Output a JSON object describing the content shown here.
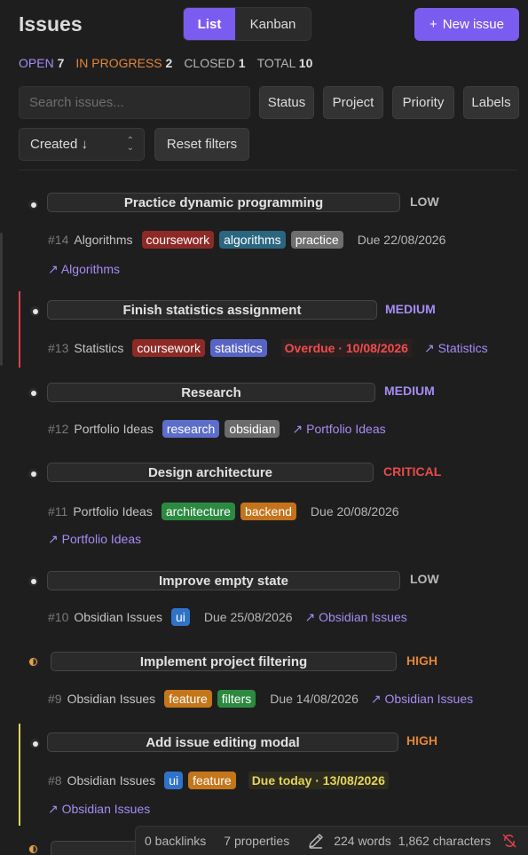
{
  "header": {
    "title": "Issues",
    "view_list": "List",
    "view_kanban": "Kanban",
    "new_issue": "New issue",
    "new_issue_icon": "+"
  },
  "stats": {
    "open_label": "OPEN",
    "open_count": "7",
    "progress_label": "IN PROGRESS",
    "progress_count": "2",
    "closed_label": "CLOSED",
    "closed_count": "1",
    "total_label": "TOTAL",
    "total_count": "10"
  },
  "filters": {
    "search_placeholder": "Search issues...",
    "status": "Status",
    "project": "Project",
    "priority": "Priority",
    "labels": "Labels",
    "sort": "Created ↓",
    "reset": "Reset filters"
  },
  "issues": [
    {
      "title": "Practice dynamic programming",
      "priority": "LOW",
      "number": "#14",
      "project": "Algorithms",
      "tags": [
        "coursework",
        "algorithms",
        "practice"
      ],
      "due": "Due 22/08/2026",
      "link": "↗ Algorithms"
    },
    {
      "title": "Finish statistics assignment",
      "priority": "MEDIUM",
      "number": "#13",
      "project": "Statistics",
      "tags": [
        "coursework",
        "statistics"
      ],
      "due": "Overdue · 10/08/2026",
      "link": "↗ Statistics"
    },
    {
      "title": "Research",
      "priority": "MEDIUM",
      "number": "#12",
      "project": "Portfolio Ideas",
      "tags": [
        "research",
        "obsidian"
      ],
      "link": "↗ Portfolio Ideas"
    },
    {
      "title": "Design architecture",
      "priority": "CRITICAL",
      "number": "#11",
      "project": "Portfolio Ideas",
      "tags": [
        "architecture",
        "backend"
      ],
      "due": "Due 20/08/2026",
      "link": "↗ Portfolio Ideas"
    },
    {
      "title": "Improve empty state",
      "priority": "LOW",
      "number": "#10",
      "project": "Obsidian Issues",
      "tags": [
        "ui"
      ],
      "due": "Due 25/08/2026",
      "link": "↗ Obsidian Issues"
    },
    {
      "title": "Implement project filtering",
      "priority": "HIGH",
      "number": "#9",
      "project": "Obsidian Issues",
      "tags": [
        "feature",
        "filters"
      ],
      "due": "Due 14/08/2026",
      "link": "↗ Obsidian Issues"
    },
    {
      "title": "Add issue editing modal",
      "priority": "HIGH",
      "number": "#8",
      "project": "Obsidian Issues",
      "tags": [
        "ui",
        "feature"
      ],
      "due": "Due today · 13/08/2026",
      "link": "↗ Obsidian Issues"
    }
  ],
  "status_bar": {
    "backlinks": "0 backlinks",
    "properties": "7 properties",
    "words": "224 words",
    "characters": "1,862 characters",
    "icons": [
      "pencil-icon",
      "sync-off-icon"
    ]
  },
  "colors": {
    "accent": "#7b5cf0",
    "low": "#b8b8b8",
    "medium": "#a58cf4",
    "high": "#e3853a",
    "critical": "#e84b4b",
    "overdue": "#ee4d4d",
    "due_today": "#e5d45a"
  }
}
